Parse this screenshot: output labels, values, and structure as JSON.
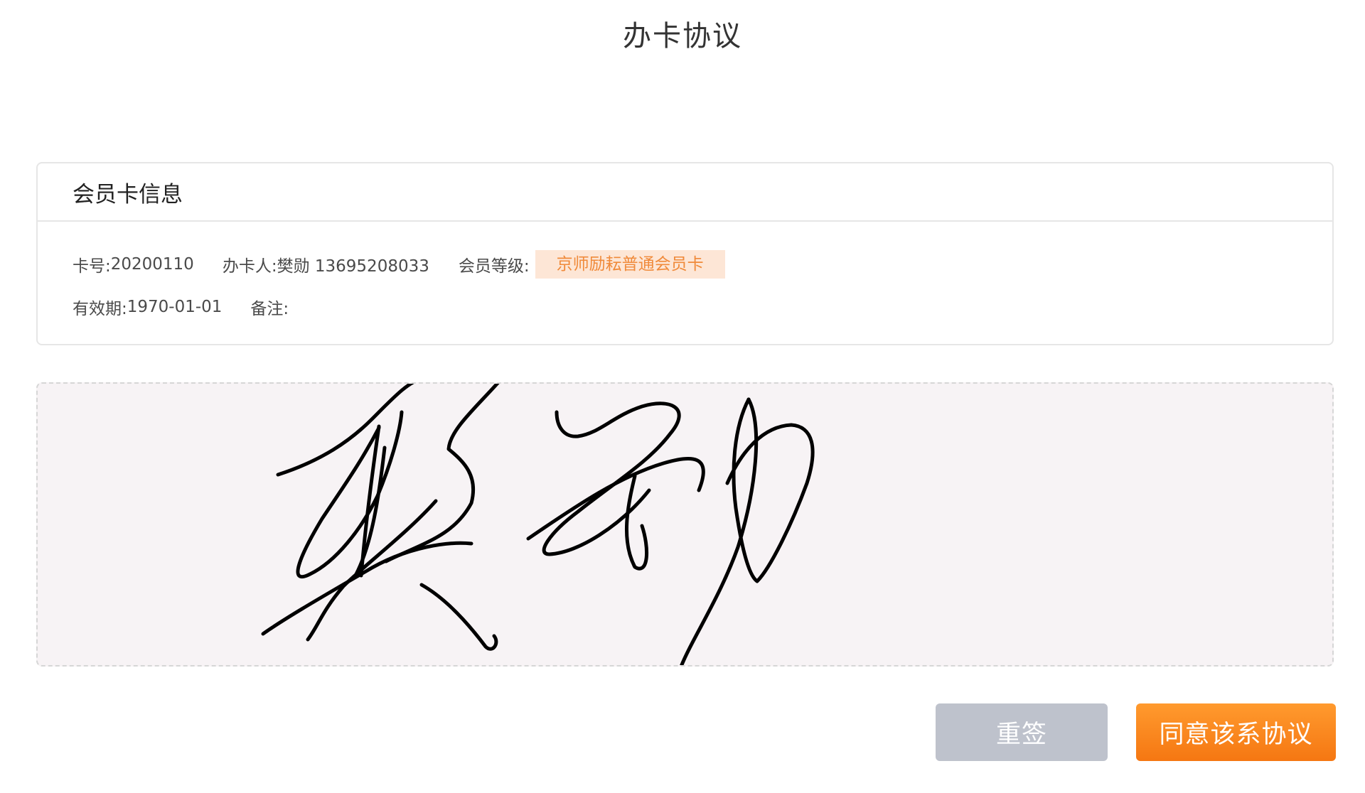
{
  "page": {
    "title": "办卡协议"
  },
  "member_card": {
    "header": "会员卡信息",
    "card_no_label": "卡号:",
    "card_no": "20200110",
    "holder_label": "办卡人:",
    "holder": "樊勋 13695208033",
    "level_label": "会员等级:",
    "level": "京师励耘普通会员卡",
    "expiry_label": "有效期:",
    "expiry": "1970-01-01",
    "remark_label": "备注:",
    "remark": ""
  },
  "signature": {
    "pad_color": "#f7f3f5",
    "stroke_color": "#000000"
  },
  "buttons": {
    "resign": "重签",
    "agree": "同意该系协议"
  },
  "colors": {
    "accent": "#f57712",
    "badge_bg": "#fde6d6",
    "badge_text": "#f08a3a",
    "disabled": "#bec2cc"
  }
}
